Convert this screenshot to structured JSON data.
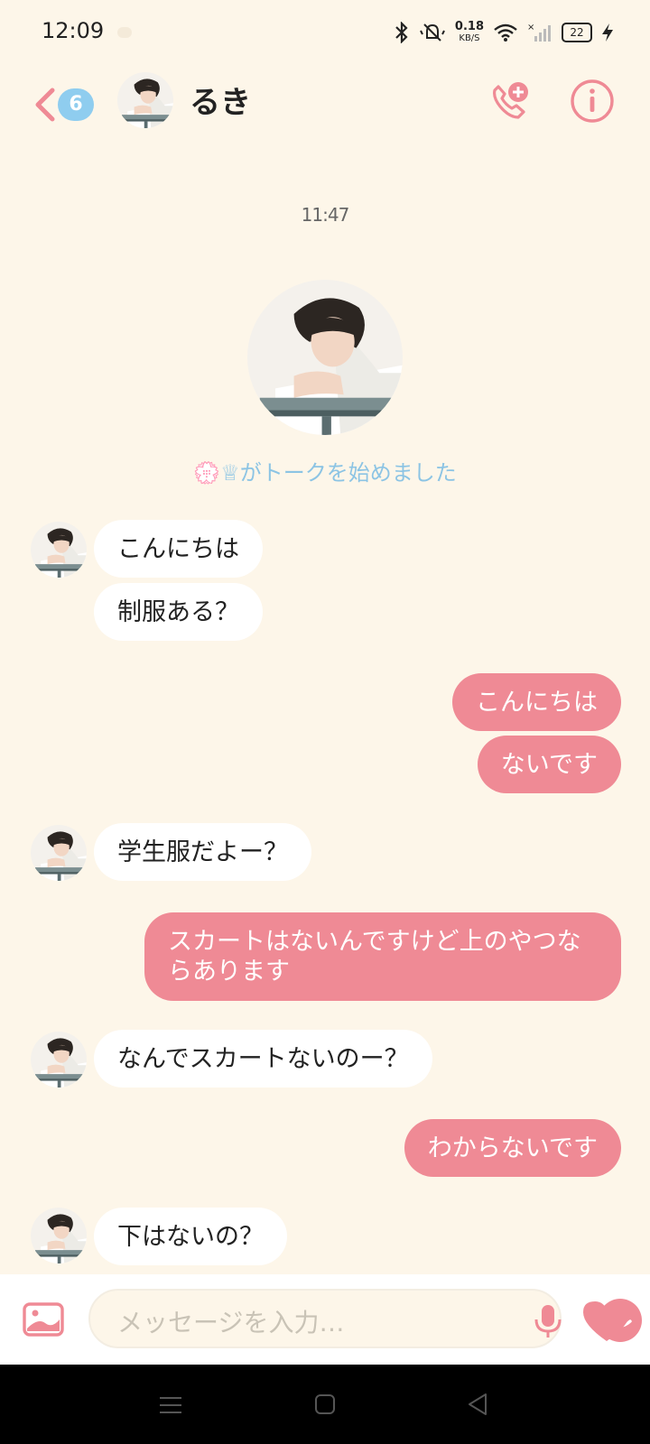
{
  "status_bar": {
    "time": "12:09",
    "net_speed": "0.18",
    "net_unit": "KB/S",
    "battery": "22"
  },
  "header": {
    "unread_count": "6",
    "contact_name": "るき",
    "call_icon": "phone-plus-icon",
    "info_icon": "info-icon"
  },
  "chat": {
    "timestamp": "11:47",
    "started_text": "💮♕がトークを始めました",
    "messages": [
      {
        "dir": "in",
        "text": "こんにちは"
      },
      {
        "dir": "in",
        "text": "制服ある？"
      },
      {
        "dir": "out",
        "text": "こんにちは"
      },
      {
        "dir": "out",
        "text": "ないです"
      },
      {
        "dir": "in",
        "text": "学生服だよー？"
      },
      {
        "dir": "out",
        "text": "スカートはないんですけど上のやつならあります"
      },
      {
        "dir": "in",
        "text": "なんでスカートないのー？"
      },
      {
        "dir": "out",
        "text": "わからないです"
      },
      {
        "dir": "in",
        "text": "下はないの？"
      }
    ]
  },
  "input_bar": {
    "placeholder": "メッセージを入力…",
    "image_icon": "image-icon",
    "mic_icon": "mic-icon",
    "emoji_icon": "emoji-icon",
    "heart_icon": "heart-icon"
  },
  "colors": {
    "background": "#fdf6e9",
    "accent_pink": "#ef8a95",
    "accent_blue": "#8fcdef",
    "incoming_bubble": "#ffffff"
  }
}
